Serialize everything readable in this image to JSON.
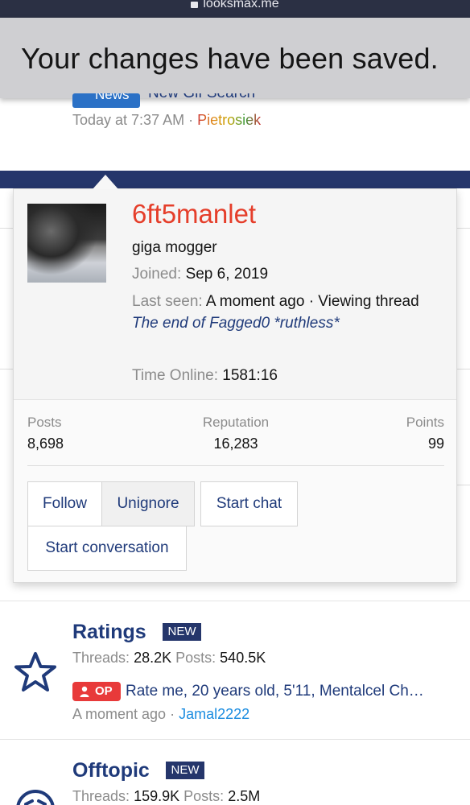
{
  "browser": {
    "url": "looksmax.me"
  },
  "toast": {
    "message": "Your changes have been saved."
  },
  "thread_snippet": {
    "prefix": "News",
    "title": "New Gif Search",
    "time": "Today at 7:37 AM",
    "separator": "·",
    "author": "Pietrosiek"
  },
  "profile_card": {
    "username": "6ft5manlet",
    "user_title": "giga mogger",
    "joined_label": "Joined:",
    "joined_value": "Sep 6, 2019",
    "last_seen_label": "Last seen:",
    "last_seen_value": "A moment ago · Viewing thread",
    "viewing_thread": "The end of Fagged0 *ruthless*",
    "time_online_label": "Time Online:",
    "time_online_value": "1581:16",
    "stats": [
      {
        "label": "Posts",
        "value": "8,698"
      },
      {
        "label": "Reputation",
        "value": "16,283"
      },
      {
        "label": "Points",
        "value": "99"
      }
    ],
    "buttons": {
      "follow": "Follow",
      "unignore": "Unignore",
      "start_chat": "Start chat",
      "start_conversation": "Start conversation"
    }
  },
  "forums": [
    {
      "name": "Ratings",
      "badge": "NEW",
      "threads_label": "Threads:",
      "threads_value": "28.2K",
      "posts_label": "Posts:",
      "posts_value": "540.5K",
      "latest_prefix": "OP",
      "latest_title": "Rate me, 20 years old, 5'11, Mentalcel Ch…",
      "latest_time": "A moment ago",
      "separator": "·",
      "latest_user": "Jamal2222",
      "icon": "star-icon"
    },
    {
      "name": "Offtopic",
      "badge": "NEW",
      "threads_label": "Threads:",
      "threads_value": "159.9K",
      "posts_label": "Posts:",
      "posts_value": "2.5M",
      "icon": "face-icon"
    }
  ],
  "colors": {
    "header": "#2b3044",
    "brand_blue": "#25366b",
    "username_red": "#e53e2a",
    "link_blue": "#1f3a7a",
    "op_red": "#e83a3a"
  }
}
